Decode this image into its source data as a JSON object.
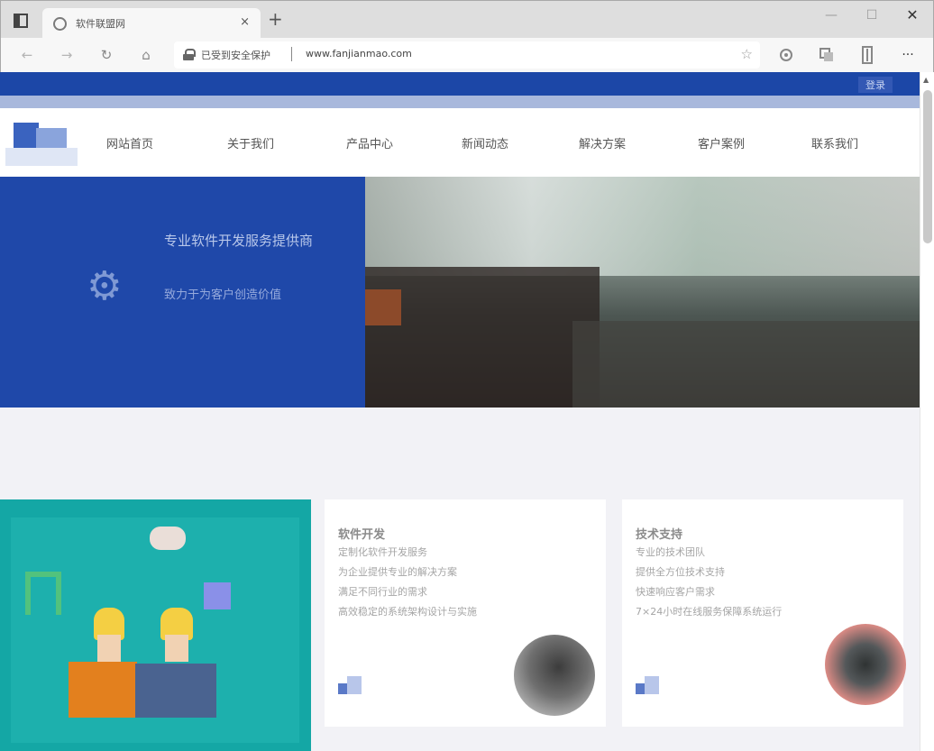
{
  "browser": {
    "tab_title": "软件联盟网",
    "tab_close": "×",
    "new_tab": "+",
    "window_controls": {
      "minimize": "—",
      "maximize": "☐",
      "close": "✕"
    },
    "toolbar": {
      "back": "←",
      "forward": "→",
      "refresh": "↻",
      "home": "⌂",
      "more": "···",
      "icons": [
        "back-arrow-icon",
        "forward-arrow-icon",
        "refresh-icon",
        "home-icon",
        "read-aloud-icon",
        "favorites-icon",
        "collections-icon",
        "account-icon",
        "more-icon"
      ]
    },
    "address_bar": {
      "site_status": "已受到安全保护",
      "url": "www.fanjianmao.com",
      "favorite_star": "☆"
    }
  },
  "page": {
    "top_strip": {
      "link": "登录"
    },
    "nav": {
      "items": [
        "网站首页",
        "关于我们",
        "产品中心",
        "新闻动态",
        "解决方案",
        "客户案例",
        "联系我们"
      ]
    },
    "hero": {
      "line1": "专业软件开发服务提供商",
      "line2": "致力于为客户创造价值"
    },
    "cards": [
      {
        "title": "软件开发",
        "text": [
          "定制化软件开发服务",
          "为企业提供专业的解决方案",
          "满足不同行业的需求",
          "高效稳定的系统架构设计与实施"
        ]
      },
      {
        "title": "技术支持",
        "text": [
          "专业的技术团队",
          "提供全方位技术支持",
          "快速响应客户需求",
          "7×24小时在线服务保障系统运行"
        ]
      }
    ]
  },
  "colors": {
    "brand_blue": "#1c47a7",
    "hero_blue": "#1f48a9",
    "teal": "#14a7a5",
    "page_bg": "#f2f2f6"
  }
}
